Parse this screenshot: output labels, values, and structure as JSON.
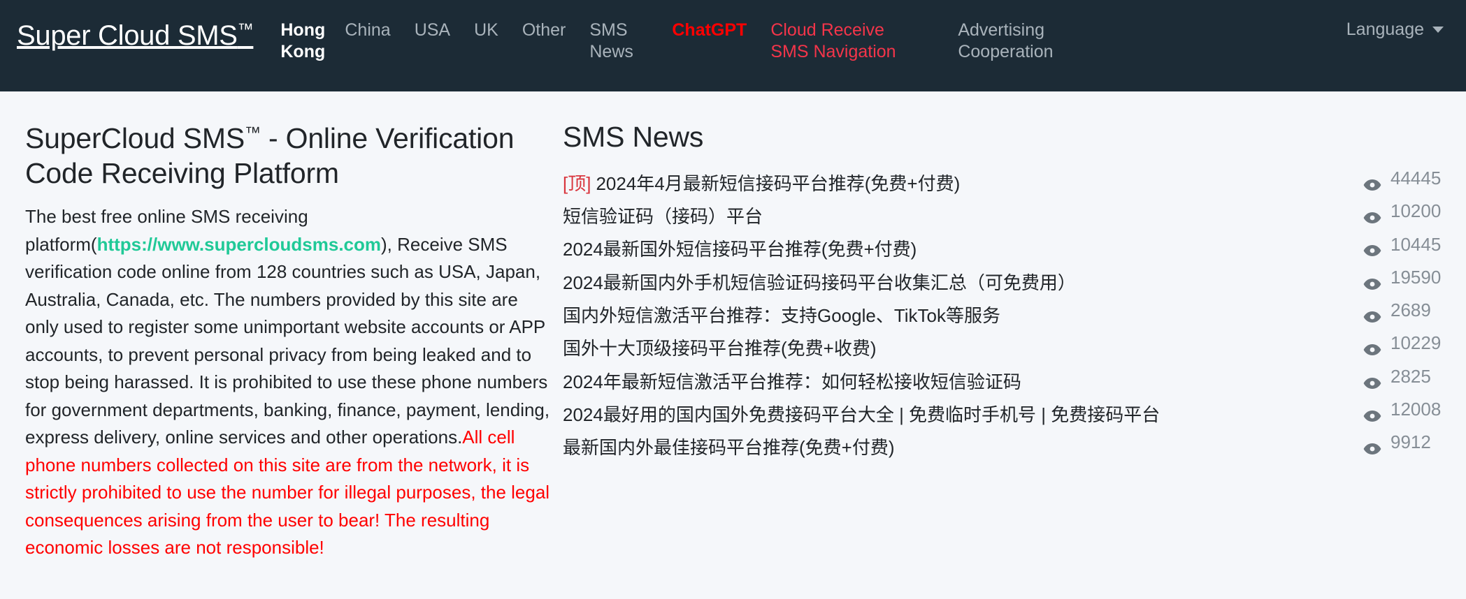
{
  "navbar": {
    "brand": "Super Cloud SMS",
    "brand_tm": "™",
    "items": [
      {
        "label": "Hong Kong",
        "state": "active",
        "icon": "nav-link"
      },
      {
        "label": "China",
        "state": "normal",
        "icon": "nav-link"
      },
      {
        "label": "USA",
        "state": "normal",
        "icon": "nav-link"
      },
      {
        "label": "UK",
        "state": "normal",
        "icon": "nav-link"
      },
      {
        "label": "Other",
        "state": "normal",
        "icon": "nav-link"
      },
      {
        "label": "SMS News",
        "state": "normal",
        "icon": "nav-link"
      },
      {
        "label": "ChatGPT",
        "state": "hot",
        "icon": "nav-link"
      },
      {
        "label": "Cloud Receive SMS Navigation",
        "state": "red",
        "icon": "nav-link"
      },
      {
        "label": "Advertising Cooperation",
        "state": "normal",
        "icon": "nav-link"
      }
    ],
    "language_label": "Language",
    "caret_icon": "chevron-down-icon",
    "colors": {
      "background": "#1c2b36",
      "link": "#a9b3bb",
      "active": "#ffffff",
      "hot": "#ff0000",
      "red": "#f4354a"
    }
  },
  "main": {
    "title": "SuperCloud SMS",
    "title_tm": "™",
    "title_rest": " - Online Verification Code Receiving Platform",
    "intro_part1": "The best free online SMS receiving platform(",
    "intro_link": "https://www.supercloudsms.com",
    "intro_part2": "),  Receive SMS verification code online from 128 countries such as USA, Japan, Australia, Canada, etc. The numbers provided by this site are only used to register some unimportant website accounts or APP accounts, to prevent personal privacy from being leaked and to stop being harassed. It is prohibited to use these phone numbers for government departments, banking, finance, payment, lending, express delivery, online services and other operations.",
    "intro_warning": "All cell phone numbers collected on this site are from the network, it is strictly prohibited to use the number for illegal purposes, the legal consequences arising from the user to bear! The resulting economic losses are not responsible!",
    "link_color": "#20c997",
    "warning_color": "#ff0000"
  },
  "news": {
    "heading": "SMS News",
    "top_tag": "[顶]",
    "views_icon": "eye-icon",
    "items": [
      {
        "tag": "[顶]",
        "title": "2024年4月最新短信接码平台推荐(免费+付费)",
        "views": "44445"
      },
      {
        "tag": "",
        "title": "短信验证码（接码）平台",
        "views": "10200"
      },
      {
        "tag": "",
        "title": "2024最新国外短信接码平台推荐(免费+付费)",
        "views": "10445"
      },
      {
        "tag": "",
        "title": "2024最新国内外手机短信验证码接码平台收集汇总（可免费用）",
        "views": "19590"
      },
      {
        "tag": "",
        "title": "国内外短信激活平台推荐：支持Google、TikTok等服务",
        "views": "2689"
      },
      {
        "tag": "",
        "title": "国外十大顶级接码平台推荐(免费+收费)",
        "views": "10229"
      },
      {
        "tag": "",
        "title": "2024年最新短信激活平台推荐：如何轻松接收短信验证码",
        "views": "2825"
      },
      {
        "tag": "",
        "title": "2024最好用的国内国外免费接码平台大全 | 免费临时手机号 | 免费接码平台",
        "views": "12008"
      },
      {
        "tag": "",
        "title": "最新国内外最佳接码平台推荐(免费+付费)",
        "views": "9912"
      }
    ]
  }
}
